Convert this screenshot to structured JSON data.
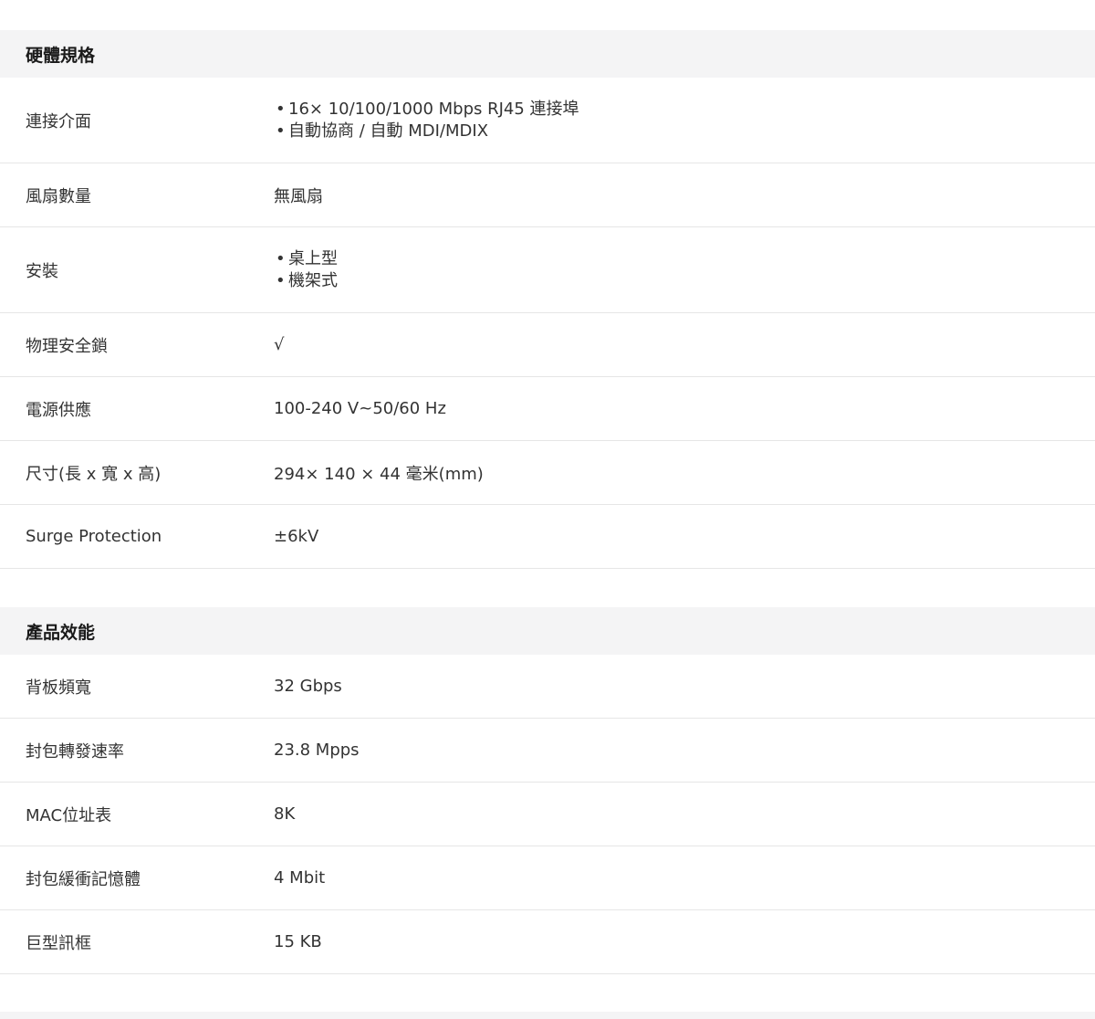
{
  "hardware": {
    "title": "硬體規格",
    "rows": [
      {
        "label": "連接介面",
        "items": [
          "16× 10/100/1000 Mbps RJ45 連接埠",
          "自動協商 / 自動 MDI/MDIX"
        ]
      },
      {
        "label": "風扇數量",
        "value": "無風扇"
      },
      {
        "label": "安裝",
        "items": [
          "桌上型",
          "機架式"
        ]
      },
      {
        "label": "物理安全鎖",
        "value": "√"
      },
      {
        "label": "電源供應",
        "value": "100-240 V~50/60 Hz"
      },
      {
        "label": "尺寸(長 x 寬 x 高)",
        "value": "294× 140 × 44 毫米(mm)"
      },
      {
        "label": "Surge Protection",
        "value": "±6kV"
      }
    ]
  },
  "performance": {
    "title": "產品效能",
    "rows": [
      {
        "label": "背板頻寬",
        "value": "32 Gbps"
      },
      {
        "label": "封包轉發速率",
        "value": "23.8 Mpps"
      },
      {
        "label": "MAC位址表",
        "value": "8K"
      },
      {
        "label": "封包緩衝記憶體",
        "value": "4 Mbit"
      },
      {
        "label": "巨型訊框",
        "value": "15 KB"
      }
    ]
  }
}
